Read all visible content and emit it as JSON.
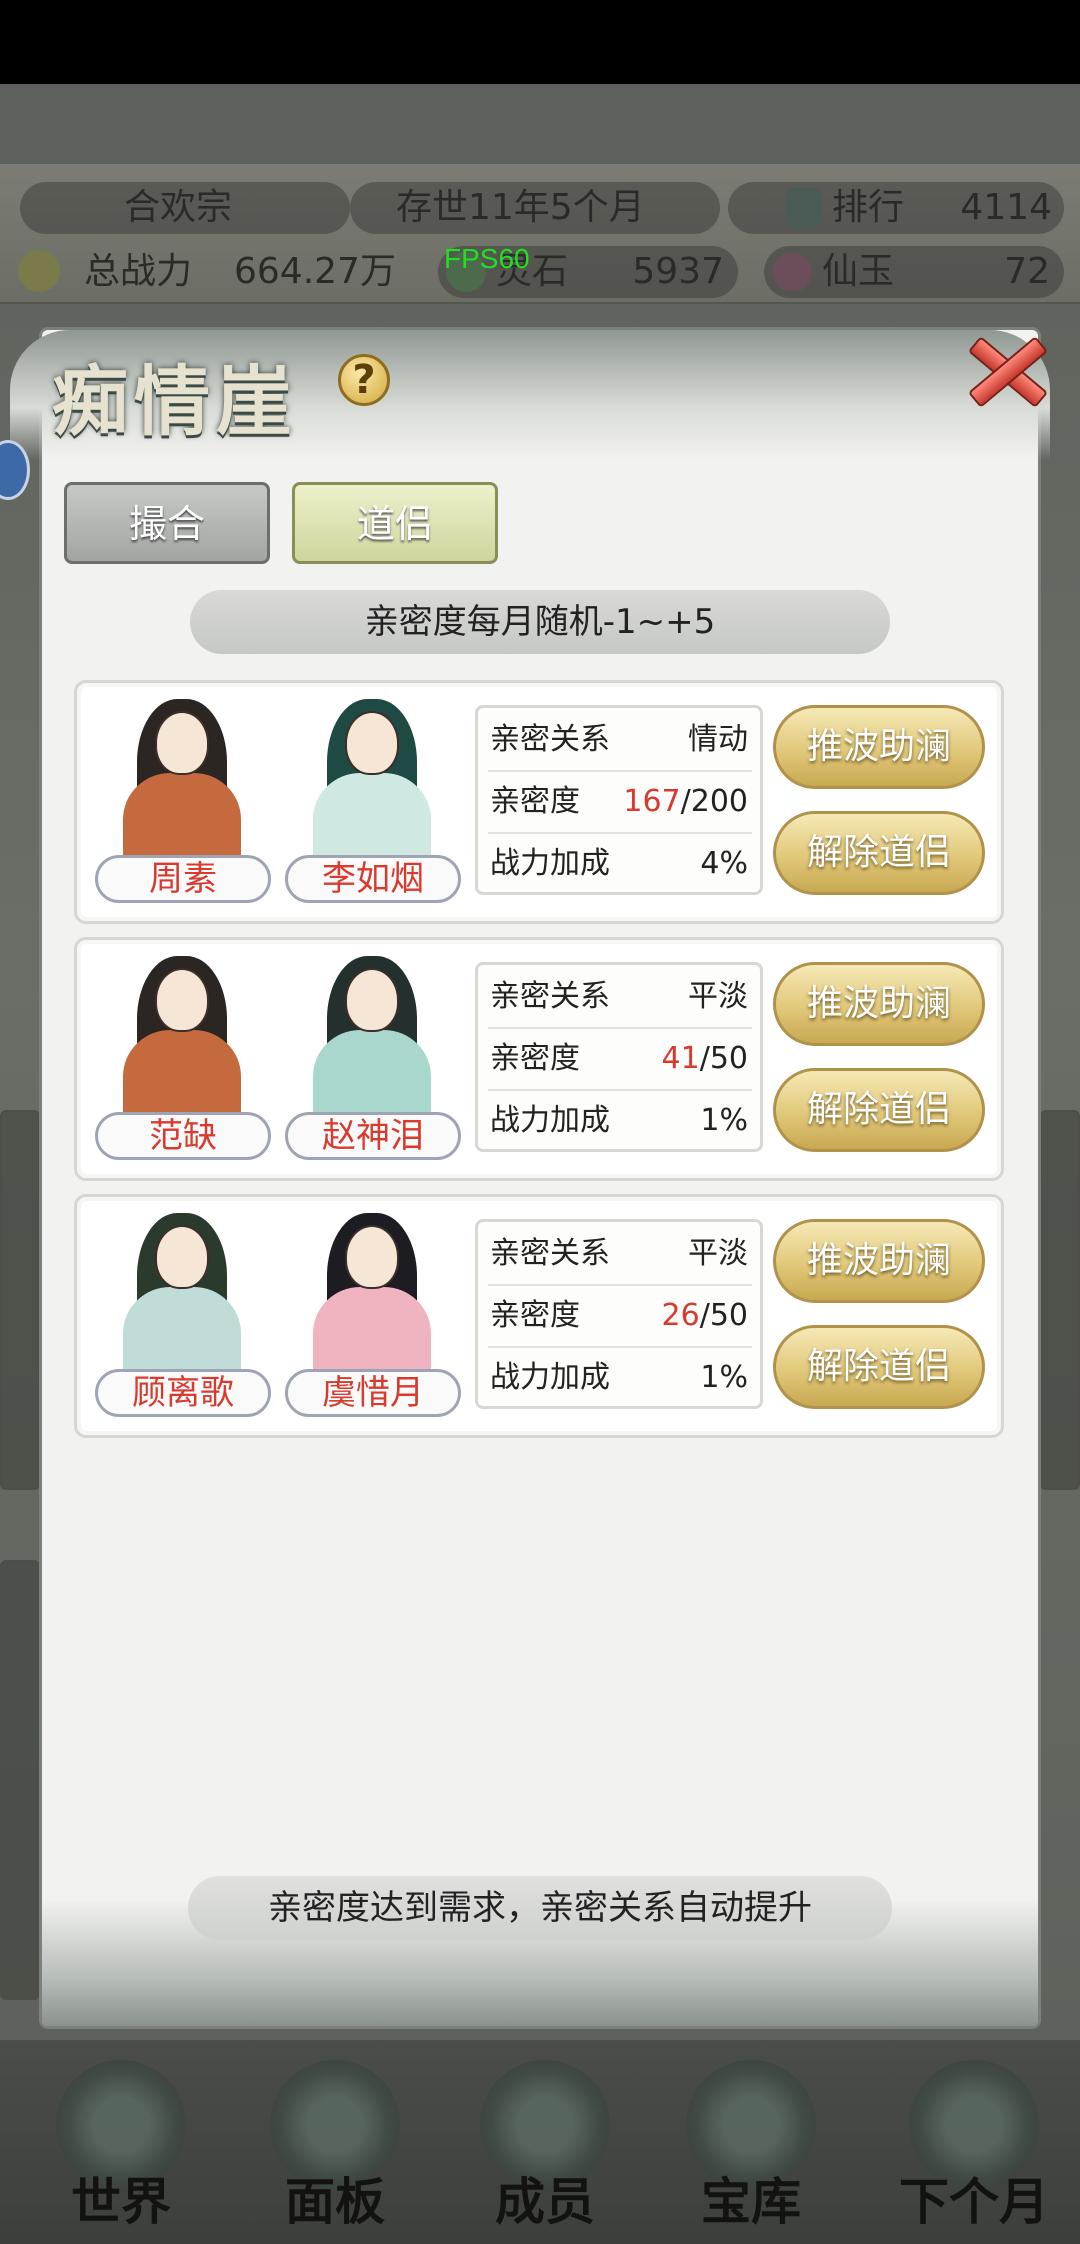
{
  "top_bar": {
    "sect_name": "合欢宗",
    "age": "存世11年5个月",
    "rank_label": "排行",
    "rank_value": "4114",
    "power_label": "总战力",
    "power_value": "664.27万",
    "fps": "FPS60",
    "spirit_stone_label": "灵石",
    "spirit_stone_value": "5937",
    "jade_label": "仙玉",
    "jade_value": "72"
  },
  "modal": {
    "title": "痴情崖",
    "help": "?",
    "tabs": [
      {
        "label": "撮合"
      },
      {
        "label": "道侣"
      }
    ],
    "info_banner": "亲密度每月随机-1~+5",
    "footer_banner": "亲密度达到需求，亲密关系自动提升",
    "row_labels": {
      "relation": "亲密关系",
      "intimacy": "亲密度",
      "power_bonus": "战力加成"
    },
    "buttons": {
      "boost": "推波助澜",
      "dissolve": "解除道侣"
    },
    "couples": [
      {
        "left_name": "周素",
        "right_name": "李如烟",
        "relation": "情动",
        "intimacy_current": "167",
        "intimacy_max": "/200",
        "power_bonus": "4%"
      },
      {
        "left_name": "范缺",
        "right_name": "赵神泪",
        "relation": "平淡",
        "intimacy_current": "41",
        "intimacy_max": "/50",
        "power_bonus": "1%"
      },
      {
        "left_name": "顾离歌",
        "right_name": "虞惜月",
        "relation": "平淡",
        "intimacy_current": "26",
        "intimacy_max": "/50",
        "power_bonus": "1%"
      }
    ]
  },
  "bottom_nav": [
    {
      "label": "世界"
    },
    {
      "label": "面板"
    },
    {
      "label": "成员"
    },
    {
      "label": "宝库"
    },
    {
      "label": "下个月"
    }
  ],
  "colors": {
    "accent_red": "#d83a2e",
    "gold_button": "#e1c87a",
    "modal_bg": "#f2f2f0"
  }
}
